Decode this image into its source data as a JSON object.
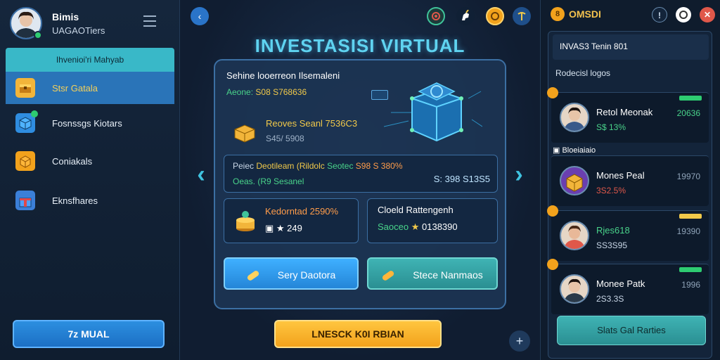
{
  "profile": {
    "name": "Bimis",
    "subtitle": "UAGAOTiers"
  },
  "sidebar": {
    "header": "Ihvenioi'ri Mahyab",
    "items": [
      {
        "label": "Stsr Gatala",
        "icon": "chest-icon"
      },
      {
        "label": "Fosnssgs Kiotars",
        "icon": "cube-icon"
      },
      {
        "label": "Coniakals",
        "icon": "box-icon"
      },
      {
        "label": "Eknsfhares",
        "icon": "gift-icon"
      }
    ],
    "bottom_button": "7z MUAL"
  },
  "center": {
    "title": "INVESTASISI VIRTUAL",
    "panel": {
      "heading": "Sehine looerreon Ilsemaleni",
      "sub_label": "Aeone:",
      "sub_value": "S08 S768636",
      "asset_name": "Reoves Seanl 7536C3",
      "asset_value": "S45/ 5908",
      "detail_parts": [
        "Peiec",
        "Deotileam (Rildolc ",
        "Seotec ",
        "S98 S 380%"
      ],
      "detail_line2": "Oeas. (R9 Sesanel",
      "detail_right": "S: 398 S13S5",
      "stat_a_title": "Kedorntad 2590%",
      "stat_a_value": "249",
      "stat_b_title": "Cloeld Rattengenh",
      "stat_b_label": "Saoceo",
      "stat_b_value": "0138390",
      "button_a": "Sery Daotora",
      "button_b": "Stece Nanmaos"
    },
    "cta": "LNESCK K0I RBIAN",
    "plus": "+",
    "back": "‹",
    "top_icons": [
      "target-icon",
      "unicorn-icon",
      "coin-icon",
      "pickaxe-icon"
    ]
  },
  "right": {
    "label": "OMSDI",
    "coin_glyph": "8",
    "title": "INVAS3 Tenin 801",
    "subtitle": "Rodecisl logos",
    "section": "Bloeiaiaio",
    "bottom_button": "Slats Gal Rarties",
    "leaders": [
      {
        "name": "Retol Meonak",
        "percent": "S$ 13%",
        "score": "20636",
        "percent_color": "#49d38a",
        "score_color": "#49d38a",
        "tag_color": "#2ecc71"
      },
      {
        "name": "Mones Peal",
        "percent": "3S2.5%",
        "score": "19970",
        "percent_color": "#e0584a",
        "score_color": "#8fa3b8",
        "tag_color": ""
      },
      {
        "name": "Rjes618",
        "percent": "SS3S95",
        "score": "19390",
        "percent_color": "#c8d6e6",
        "score_color": "#8fa3b8",
        "tag_color": "#f1c94a"
      },
      {
        "name": "Monee Patk",
        "percent": "2S3.3S",
        "score": "1996",
        "percent_color": "#c8d6e6",
        "score_color": "#8fa3b8",
        "tag_color": "#2ecc71"
      }
    ]
  }
}
